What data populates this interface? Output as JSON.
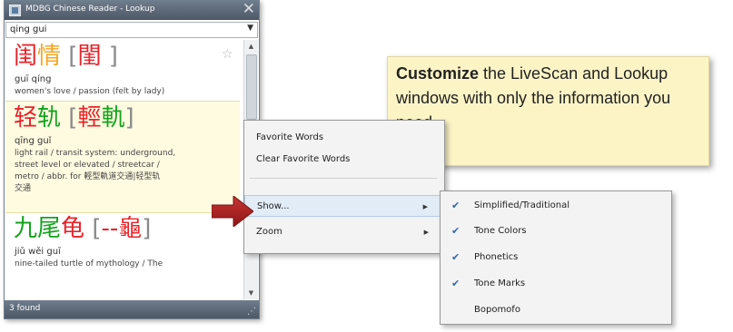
{
  "window": {
    "title": "MDBG Chinese Reader - Lookup",
    "close_glyph": "✕",
    "search": {
      "value": "qing gui",
      "dropdown_glyph": "▼"
    },
    "status": "3 found",
    "entries": [
      {
        "hanzi_simplified": [
          {
            "char": "闺",
            "tone_color": "red"
          },
          {
            "char": "情",
            "tone_color": "orange"
          }
        ],
        "bracket_open": "[",
        "hanzi_traditional": [
          {
            "char": "閨",
            "tone_color": "red"
          }
        ],
        "trad_spacer": " ",
        "bracket_close": "]",
        "pinyin": "guī qíng",
        "definition": "women's love / passion (felt by lady)",
        "favorite_glyph": "☆"
      },
      {
        "hanzi_simplified": [
          {
            "char": "轻",
            "tone_color": "red"
          },
          {
            "char": "轨",
            "tone_color": "green"
          }
        ],
        "bracket_open": "[",
        "hanzi_traditional": [
          {
            "char": "輕",
            "tone_color": "red"
          },
          {
            "char": "軌",
            "tone_color": "green"
          }
        ],
        "bracket_close": "]",
        "pinyin": "qīng guǐ",
        "definition_lines": [
          "light rail / transit system: underground,",
          "street level or elevated / streetcar /",
          "metro / abbr. for 輕型軌道交通|轻型轨",
          "交通"
        ]
      },
      {
        "hanzi_simplified": [
          {
            "char": "九",
            "tone_color": "green"
          },
          {
            "char": "尾",
            "tone_color": "green"
          },
          {
            "char": "龟",
            "tone_color": "red"
          }
        ],
        "bracket_open": "[",
        "trad_placeholder": "--",
        "hanzi_traditional": [
          {
            "char": "龜",
            "tone_color": "red"
          }
        ],
        "bracket_close": "]",
        "pinyin": "jiǔ wěi guī",
        "definition": "nine-tailed turtle of mythology / The"
      }
    ]
  },
  "context_menu": {
    "items": [
      {
        "label": "Favorite Words",
        "submenu": false
      },
      {
        "label": "Clear Favorite Words",
        "submenu": false
      },
      {
        "label": "Show...",
        "submenu": true,
        "highlighted": true
      },
      {
        "label": "Zoom",
        "submenu": true
      }
    ],
    "submenu_arrow_glyph": "▶"
  },
  "show_submenu": {
    "check_glyph": "✔",
    "items": [
      {
        "label": "Simplified/Traditional",
        "checked": true
      },
      {
        "label": "Tone Colors",
        "checked": true
      },
      {
        "label": "Phonetics",
        "checked": true
      },
      {
        "label": "Tone Marks",
        "checked": true
      },
      {
        "label": "Bopomofo",
        "checked": false
      }
    ]
  },
  "callout": {
    "bold": "Customize",
    "text": " the LiveScan and Lookup windows with only the information you need"
  },
  "colors": {
    "tone_red": "#e8242b",
    "tone_orange": "#f5a623",
    "tone_green": "#15a31d",
    "pointer_arrow": "#a61b1b",
    "callout_bg": "#fdf4c6",
    "selected_entry_bg": "#fffbe1"
  }
}
